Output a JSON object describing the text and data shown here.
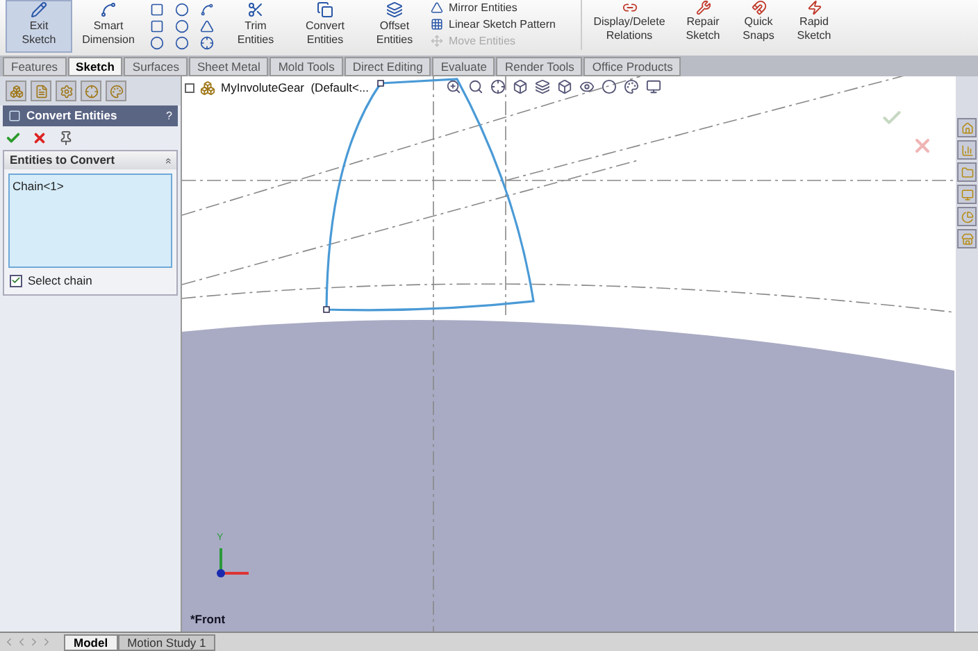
{
  "ribbon": {
    "large_buttons": [
      {
        "label": "Exit Sketch",
        "active": true
      },
      {
        "label": "Smart Dimension",
        "active": false
      },
      {
        "label": "Trim Entities",
        "active": false
      },
      {
        "label": "Convert Entities",
        "active": false
      },
      {
        "label": "Offset Entities",
        "active": false
      }
    ],
    "list_tools": [
      {
        "label": "Mirror Entities",
        "disabled": false
      },
      {
        "label": "Linear Sketch Pattern",
        "disabled": false
      },
      {
        "label": "Move Entities",
        "disabled": true
      }
    ],
    "right_buttons": [
      {
        "label": "Display/Delete Relations",
        "active": false
      },
      {
        "label": "Repair Sketch",
        "active": false
      },
      {
        "label": "Quick Snaps",
        "active": false
      },
      {
        "label": "Rapid Sketch",
        "active": false
      }
    ]
  },
  "tabs": [
    {
      "label": "Features",
      "selected": false
    },
    {
      "label": "Sketch",
      "selected": true
    },
    {
      "label": "Surfaces",
      "selected": false
    },
    {
      "label": "Sheet Metal",
      "selected": false
    },
    {
      "label": "Mold Tools",
      "selected": false
    },
    {
      "label": "Direct Editing",
      "selected": false
    },
    {
      "label": "Evaluate",
      "selected": false
    },
    {
      "label": "Render Tools",
      "selected": false
    },
    {
      "label": "Office Products",
      "selected": false
    }
  ],
  "property_manager": {
    "title": "Convert Entities",
    "help": "?",
    "section": {
      "title": "Entities to Convert",
      "collapse": "«",
      "items": [
        "Chain<1>"
      ]
    },
    "select_chain": {
      "label": "Select chain",
      "checked": true
    }
  },
  "viewport": {
    "tree_item": "MyInvoluteGear  (Default<...",
    "triad_label": "Y",
    "view_name": "*Front"
  },
  "bottom_tabs": [
    {
      "label": "Model",
      "selected": true
    },
    {
      "label": "Motion Study 1",
      "selected": false
    }
  ]
}
